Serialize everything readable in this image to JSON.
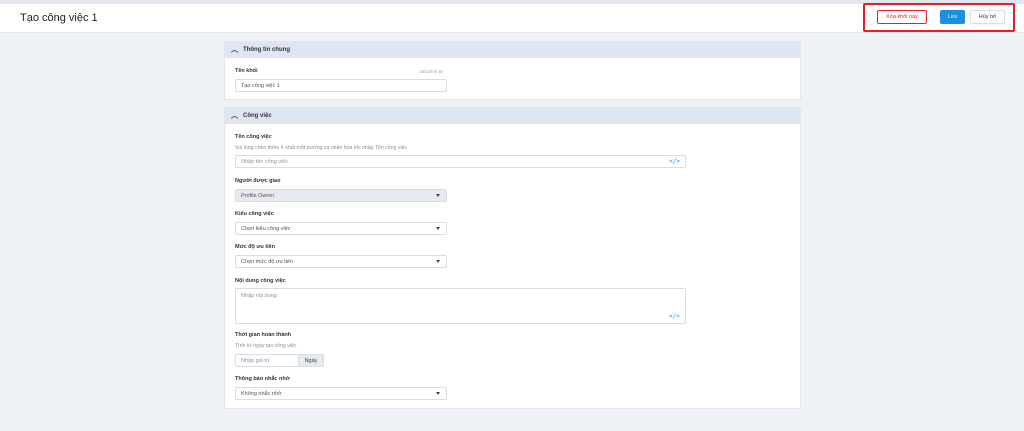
{
  "header": {
    "title": "Tạo công việc 1",
    "delete_label": "Xóa khối này",
    "save_label": "Lưu",
    "cancel_label": "Hủy bỏ"
  },
  "general": {
    "section_title": "Thông tin chung",
    "name_label": "Tên khối",
    "name_counter": "15/128 kí tự",
    "name_value": "Tạo công việc 1"
  },
  "task": {
    "section_title": "Công việc",
    "task_name_label": "Tên công việc",
    "task_name_hint": "Vui lòng chèn thêm ít nhất một trường cá nhân hóa khi nhập Tên công việc",
    "task_name_placeholder": "Nhập tên công việc",
    "assignee_label": "Người được giao",
    "assignee_value": "Profile Owner",
    "type_label": "Kiểu công việc",
    "type_placeholder": "Chọn kiểu công việc",
    "priority_label": "Mức độ ưu tiên",
    "priority_placeholder": "Chọn mức độ ưu tiên",
    "content_label": "Nội dung công việc",
    "content_placeholder": "Nhập nội dung",
    "deadline_label": "Thời gian hoàn thành",
    "deadline_hint": "Tính từ ngày tạo công việc",
    "deadline_placeholder": "Nhập giá trị",
    "deadline_unit": "Ngày",
    "reminder_label": "Thông báo nhắc nhở",
    "reminder_value": "Không nhắc nhở"
  },
  "icons": {
    "collapse": "chevron-up-icon",
    "dropdown": "caret-down-icon",
    "personalize": "code-icon"
  },
  "colors": {
    "accent": "#1b8fe2",
    "danger": "#e5202e",
    "section_header_bg": "#dde6f1",
    "page_bg": "#eef1f6"
  }
}
